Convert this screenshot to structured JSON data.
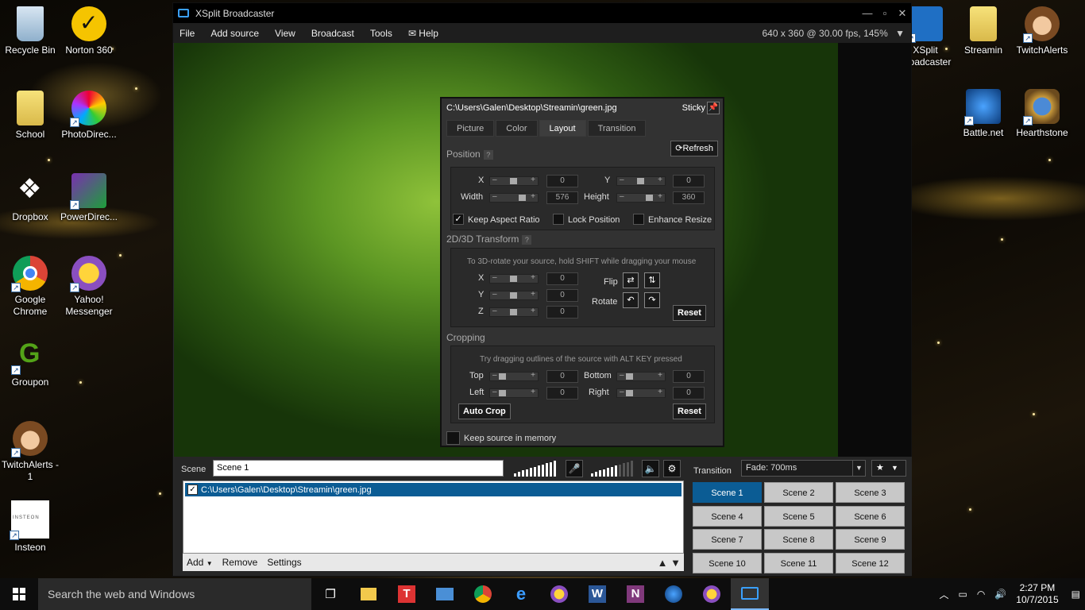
{
  "desktop": {
    "left_icons": [
      {
        "label": "Recycle Bin"
      },
      {
        "label": "Norton 360"
      },
      {
        "label": "School"
      },
      {
        "label": "PhotoDirec..."
      },
      {
        "label": "Dropbox"
      },
      {
        "label": "PowerDirec..."
      },
      {
        "label": "Google Chrome"
      },
      {
        "label": "Yahoo! Messenger"
      },
      {
        "label": "Groupon"
      },
      {
        "label": "TwitchAlerts - 1"
      },
      {
        "label": "Insteon"
      }
    ],
    "right_icons": [
      {
        "label": "XSplit Broadcaster"
      },
      {
        "label": "Streamin"
      },
      {
        "label": "TwitchAlerts"
      },
      {
        "label": "Battle.net"
      },
      {
        "label": "Hearthstone"
      }
    ],
    "insteon_logo_text": "INSTEON"
  },
  "window": {
    "title": "XSplit Broadcaster",
    "menu": [
      "File",
      "Add source",
      "View",
      "Broadcast",
      "Tools",
      "Help"
    ],
    "resolution": "640 x 360 @ 30.00 fps, 145%"
  },
  "popup": {
    "path": "C:\\Users\\Galen\\Desktop\\Streamin\\green.jpg",
    "sticky": "Sticky",
    "tabs": [
      "Picture",
      "Color",
      "Layout",
      "Transition"
    ],
    "active_tab": "Layout",
    "position_title": "Position",
    "refresh": "Refresh",
    "x_label": "X",
    "x_value": "0",
    "y_label": "Y",
    "y_value": "0",
    "width_label": "Width",
    "width_value": "576",
    "height_label": "Height",
    "height_value": "360",
    "keep_aspect": "Keep Aspect Ratio",
    "lock_position": "Lock Position",
    "enhance_resize": "Enhance Resize",
    "transform_title": "2D/3D Transform",
    "transform_hint": "To 3D-rotate your source, hold SHIFT while dragging your mouse",
    "tx_label": "X",
    "tx_value": "0",
    "ty_label": "Y",
    "ty_value": "0",
    "tz_label": "Z",
    "tz_value": "0",
    "flip": "Flip",
    "rotate": "Rotate",
    "reset": "Reset",
    "cropping_title": "Cropping",
    "crop_hint": "Try dragging outlines of the source with ALT KEY pressed",
    "top_label": "Top",
    "top_value": "0",
    "bottom_label": "Bottom",
    "bottom_value": "0",
    "left_label": "Left",
    "left_value": "0",
    "right_label": "Right",
    "right_value": "0",
    "auto_crop": "Auto Crop",
    "keep_memory": "Keep source in memory"
  },
  "bottom": {
    "scene_label": "Scene",
    "scene_name": "Scene 1",
    "source_item": "C:\\Users\\Galen\\Desktop\\Streamin\\green.jpg",
    "add": "Add",
    "remove": "Remove",
    "settings": "Settings",
    "transition_label": "Transition",
    "transition_value": "Fade: 700ms",
    "scenes": [
      "Scene 1",
      "Scene 2",
      "Scene 3",
      "Scene 4",
      "Scene 5",
      "Scene 6",
      "Scene 7",
      "Scene 8",
      "Scene 9",
      "Scene 10",
      "Scene 11",
      "Scene 12"
    ],
    "active_scene": "Scene 1"
  },
  "taskbar": {
    "search_placeholder": "Search the web and Windows",
    "time": "2:27 PM",
    "date": "10/7/2015"
  },
  "colors": {
    "accent": "#0b5c94",
    "titlebar": "#000000",
    "panel": "#2b2b2b"
  }
}
